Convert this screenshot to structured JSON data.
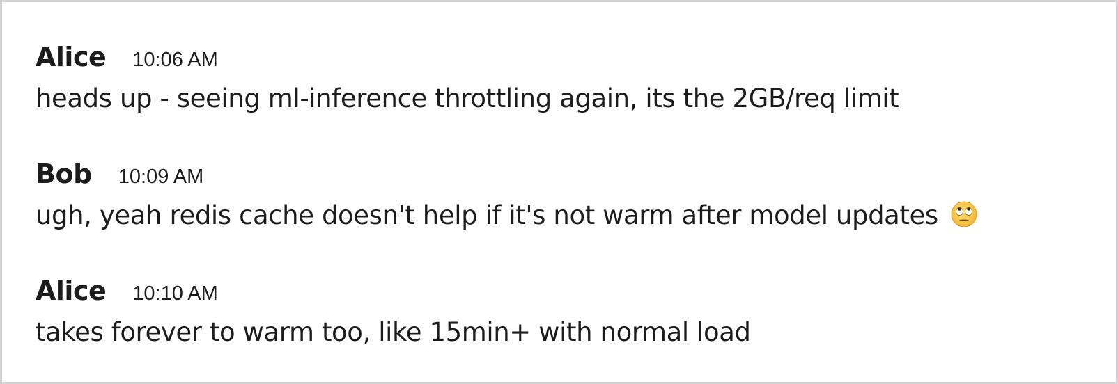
{
  "messages": [
    {
      "author": "Alice",
      "time": "10:06 AM",
      "text": "heads up - seeing ml-inference throttling again, its the 2GB/req limit"
    },
    {
      "author": "Bob",
      "time": "10:09 AM",
      "text": "ugh, yeah redis cache doesn't help if it's not warm after model updates",
      "emoji": "face-with-rolling-eyes-emoji"
    },
    {
      "author": "Alice",
      "time": "10:10 AM",
      "text": "takes forever to warm too, like 15min+ with normal load"
    }
  ],
  "colors": {
    "text": "#1d1c1d",
    "border": "#d3d3d8",
    "background": "#ffffff",
    "emoji_face": "#f7c948"
  }
}
